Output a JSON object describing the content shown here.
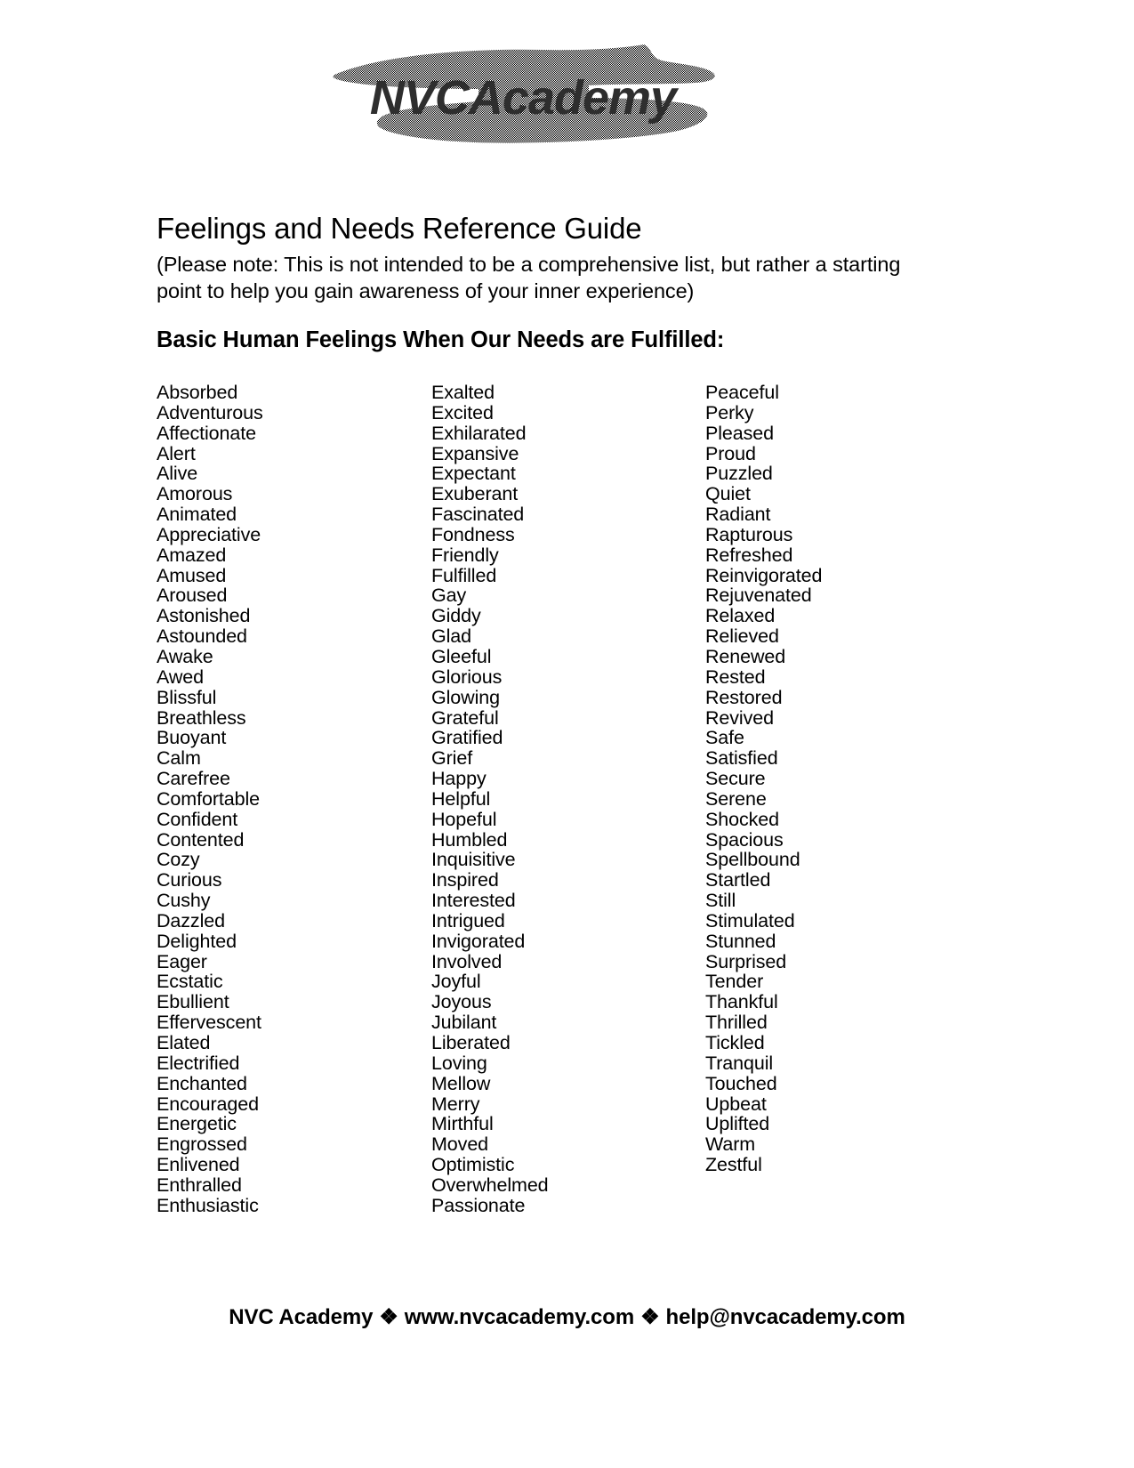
{
  "logo": {
    "text": "NVCAcademy",
    "style": "dithered-halftone-brushstroke",
    "ink_color": "#3a3a3a"
  },
  "header": {
    "title": "Feelings and Needs Reference Guide",
    "note": "(Please note: This is not intended to be a comprehensive list, but rather a starting point to help you gain awareness of your inner experience)",
    "section_heading": "Basic Human Feelings When Our Needs are Fulfilled:"
  },
  "columns": [
    {
      "id": "column-1",
      "words": [
        "Absorbed",
        "Adventurous",
        "Affectionate",
        "Alert",
        "Alive",
        "Amorous",
        "Animated",
        "Appreciative",
        "Amazed",
        "Amused",
        "Aroused",
        "Astonished",
        "Astounded",
        "Awake",
        "Awed",
        "Blissful",
        "Breathless",
        "Buoyant",
        "Calm",
        "Carefree",
        "Comfortable",
        "Confident",
        "Contented",
        "Cozy",
        "Curious",
        "Cushy",
        "Dazzled",
        "Delighted",
        "Eager",
        "Ecstatic",
        "Ebullient",
        "Effervescent",
        "Elated",
        "Electrified",
        "Enchanted",
        "Encouraged",
        "Energetic",
        "Engrossed",
        "Enlivened",
        "Enthralled",
        "Enthusiastic"
      ]
    },
    {
      "id": "column-2",
      "words": [
        "Exalted",
        "Excited",
        "Exhilarated",
        "Expansive",
        "Expectant",
        "Exuberant",
        "Fascinated",
        "Fondness",
        "Friendly",
        "Fulfilled",
        "Gay",
        "Giddy",
        "Glad",
        "Gleeful",
        "Glorious",
        "Glowing",
        "Grateful",
        "Gratified",
        "Grief",
        "Happy",
        "Helpful",
        "Hopeful",
        "Humbled",
        "Inquisitive",
        "Inspired",
        "Interested",
        "Intrigued",
        "Invigorated",
        "Involved",
        "Joyful",
        "Joyous",
        "Jubilant",
        "Liberated",
        "Loving",
        "Mellow",
        "Merry",
        "Mirthful",
        "Moved",
        "Optimistic",
        "Overwhelmed",
        "Passionate"
      ]
    },
    {
      "id": "column-3",
      "words": [
        "Peaceful",
        "Perky",
        "Pleased",
        "Proud",
        "Puzzled",
        "Quiet",
        "Radiant",
        "Rapturous",
        "Refreshed",
        "Reinvigorated",
        "Rejuvenated",
        "Relaxed",
        "Relieved",
        "Renewed",
        "Rested",
        "Restored",
        "Revived",
        "Safe",
        "Satisfied",
        "Secure",
        "Serene",
        "Shocked",
        "Spacious",
        "Spellbound",
        "Startled",
        "Still",
        "Stimulated",
        "Stunned",
        "Surprised",
        "Tender",
        "Thankful",
        "Thrilled",
        "Tickled",
        "Tranquil",
        "Touched",
        "Upbeat",
        "Uplifted",
        "Warm",
        "Zestful"
      ]
    }
  ],
  "footer": {
    "org": "NVC Academy",
    "separator": "❖",
    "website": "www.nvcacademy.com",
    "email": "help@nvcacademy.com"
  }
}
